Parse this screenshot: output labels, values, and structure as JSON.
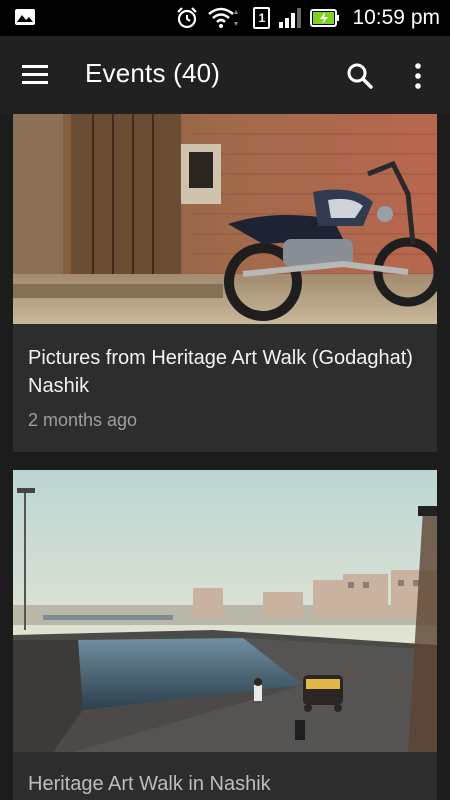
{
  "status_bar": {
    "time": "10:59 pm",
    "sim_label": "1",
    "icons": [
      "image-icon",
      "alarm-icon",
      "wifi-icon",
      "sim-icon",
      "signal-icon",
      "battery-charging-icon"
    ]
  },
  "app_bar": {
    "title": "Events (40)",
    "menu_icon": "hamburger-menu-icon",
    "search_icon": "search-icon",
    "more_icon": "more-vert-icon"
  },
  "events": [
    {
      "title": "Pictures from Heritage Art Walk (Godaghat) Nashik",
      "time_ago": "2 months ago",
      "image": "photo of old motorcycle in front of brick wall and wooden door"
    },
    {
      "title": "Heritage Art Walk in Nashik",
      "time_ago": "",
      "image": "photo of river ghat with buildings and auto rickshaw at dawn"
    }
  ],
  "colors": {
    "background": "#1c1c1c",
    "app_bar": "#212121",
    "card": "#2d2d2d",
    "status_bar": "#000000",
    "battery_green": "#7ed321"
  }
}
